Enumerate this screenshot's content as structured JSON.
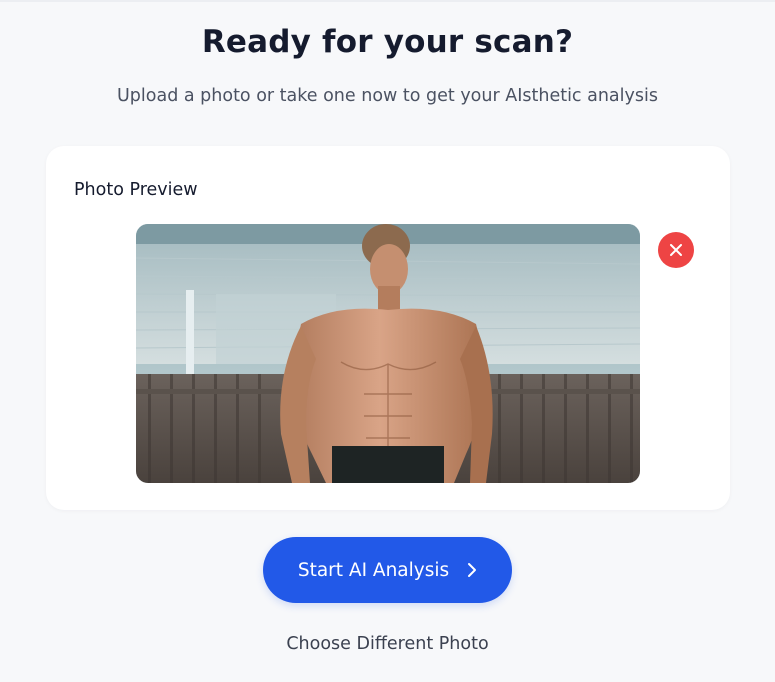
{
  "header": {
    "title": "Ready for your scan?",
    "subtitle": "Upload a photo or take one now to get your AIsthetic analysis"
  },
  "preview": {
    "label": "Photo Preview",
    "remove_icon": "close-icon"
  },
  "actions": {
    "start_label": "Start AI Analysis",
    "start_icon": "chevron-right-icon",
    "choose_label": "Choose Different Photo"
  },
  "colors": {
    "background": "#f7f8fa",
    "card": "#ffffff",
    "title": "#151b2e",
    "subtitle": "#4b5262",
    "primary": "#2259e8",
    "remove": "#ee4444"
  }
}
